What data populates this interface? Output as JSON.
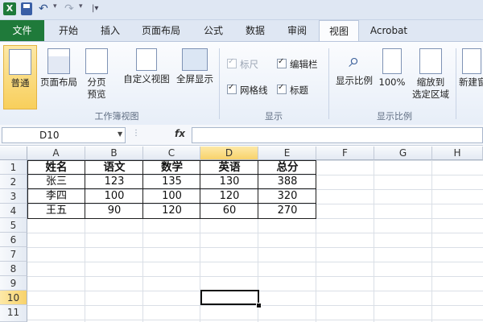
{
  "app": {
    "logo_letter": "X"
  },
  "qat": {
    "undo_glyph": "↶",
    "redo_glyph": "↷",
    "more_glyph": "|▾"
  },
  "tabs": [
    {
      "label": "文件"
    },
    {
      "label": "开始"
    },
    {
      "label": "插入"
    },
    {
      "label": "页面布局"
    },
    {
      "label": "公式"
    },
    {
      "label": "数据"
    },
    {
      "label": "审阅"
    },
    {
      "label": "视图"
    },
    {
      "label": "Acrobat"
    }
  ],
  "ribbon": {
    "workbook_views": {
      "group_label": "工作簿视图",
      "normal": "普通",
      "page_layout": "页面布局",
      "page_break_1": "分页",
      "page_break_2": "预览",
      "custom_views": "自定义视图",
      "full_screen": "全屏显示"
    },
    "show": {
      "group_label": "显示",
      "ruler": "标尺",
      "formula_bar": "编辑栏",
      "gridlines": "网格线",
      "headings": "标题"
    },
    "zoom": {
      "group_label": "显示比例",
      "zoom": "显示比例",
      "zoom_100": "100%",
      "zoom_selection_1": "缩放到",
      "zoom_selection_2": "选定区域"
    },
    "window": {
      "new_window": "新建窗"
    }
  },
  "formula_bar": {
    "name_box": "D10",
    "fx_label": "fx",
    "value": ""
  },
  "sheet": {
    "columns": [
      "A",
      "B",
      "C",
      "D",
      "E",
      "F",
      "G",
      "H"
    ],
    "rows": [
      "1",
      "2",
      "3",
      "4",
      "5",
      "6",
      "7",
      "8",
      "9",
      "10",
      "11"
    ],
    "selected_column": "D",
    "selected_row": "10",
    "table": {
      "headers": [
        "姓名",
        "语文",
        "数学",
        "英语",
        "总分"
      ],
      "data": [
        [
          "张三",
          "123",
          "135",
          "130",
          "388"
        ],
        [
          "李四",
          "100",
          "100",
          "120",
          "320"
        ],
        [
          "王五",
          "90",
          "120",
          "60",
          "270"
        ]
      ]
    }
  },
  "colors": {
    "excel_green": "#1f7a3a",
    "selection_highlight": "#f8d26a",
    "ribbon_bg": "#e7eef8"
  }
}
